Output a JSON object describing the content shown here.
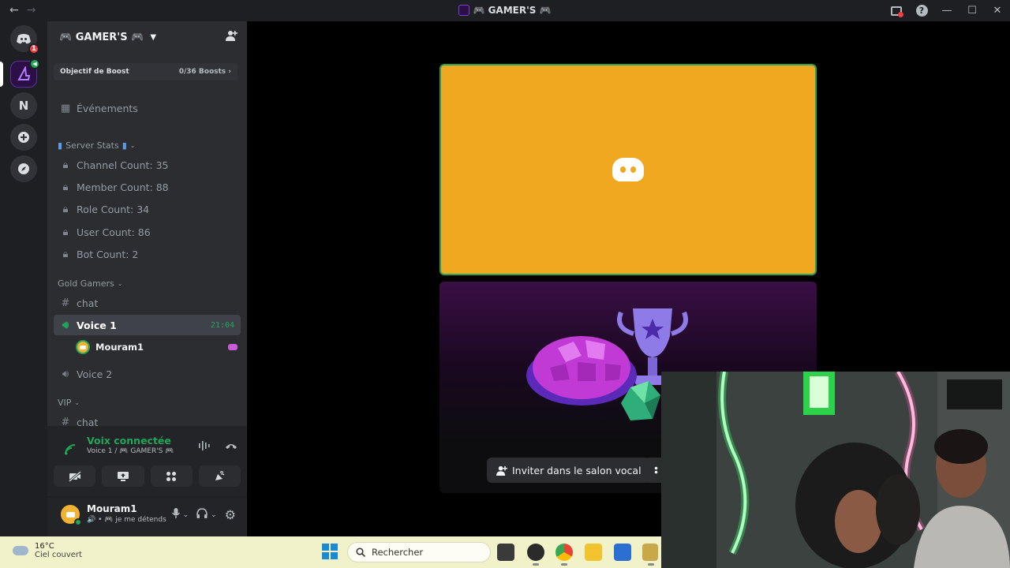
{
  "window": {
    "title": "🎮 GAMER'S 🎮",
    "help_glyph": "?"
  },
  "rail": {
    "home_badge": "1",
    "n_server": "N"
  },
  "server": {
    "name": "🎮 GAMER'S 🎮",
    "boost_label": "Objectif de Boost",
    "boost_count": "0/36 Boosts"
  },
  "channels": {
    "events": "Événements",
    "category_stats": "Server Stats",
    "stats": [
      "Channel Count: 35",
      "Member Count: 88",
      "Role Count: 34",
      "User Count: 86",
      "Bot Count: 2"
    ],
    "category_gold": "Gold Gamers",
    "gold_chat": "chat",
    "voice1": "Voice 1",
    "voice1_time": "21:04",
    "voice1_user": "Mouram1",
    "voice2": "Voice 2",
    "category_vip": "VIP",
    "vip_chat": "chat"
  },
  "voice_panel": {
    "title": "Voix connectée",
    "subtitle": "Voice 1 / 🎮 GAMER'S 🎮"
  },
  "user_panel": {
    "name": "Mouram1",
    "status": "🔊 • 🎮 je me détends"
  },
  "stage": {
    "invite_label": "Inviter dans le salon vocal"
  },
  "taskbar": {
    "temperature": "16°C",
    "weather": "Ciel couvert",
    "search_placeholder": "Rechercher"
  },
  "colors": {
    "accent_green": "#23a559",
    "tile_orange": "#f0a821",
    "sidebar": "#2b2d31",
    "rail": "#1e1f22"
  }
}
